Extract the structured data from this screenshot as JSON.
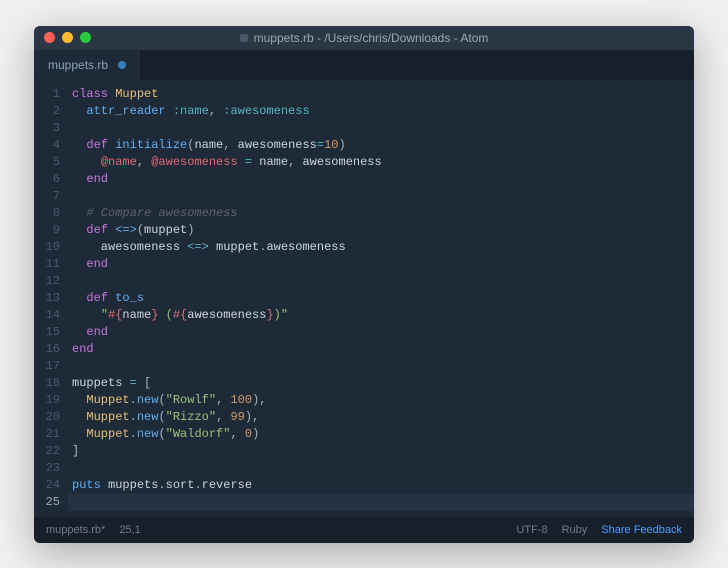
{
  "window": {
    "title": "muppets.rb - /Users/chris/Downloads - Atom"
  },
  "tab": {
    "label": "muppets.rb",
    "modified": true
  },
  "cursor": {
    "line": 25,
    "col": 1
  },
  "status": {
    "file": "muppets.rb*",
    "position": "25,1",
    "encoding": "UTF-8",
    "language": "Ruby",
    "feedback": "Share Feedback"
  },
  "code": {
    "lines": [
      {
        "n": 1,
        "t": [
          [
            "kw",
            "class"
          ],
          [
            "",
            " "
          ],
          [
            "cls",
            "Muppet"
          ]
        ]
      },
      {
        "n": 2,
        "t": [
          [
            "",
            "  "
          ],
          [
            "fn",
            "attr_reader"
          ],
          [
            "",
            " "
          ],
          [
            "sym",
            ":name"
          ],
          [
            "pun",
            ","
          ],
          [
            "",
            " "
          ],
          [
            "sym",
            ":awesomeness"
          ]
        ]
      },
      {
        "n": 3,
        "t": []
      },
      {
        "n": 4,
        "t": [
          [
            "",
            "  "
          ],
          [
            "kw",
            "def"
          ],
          [
            "",
            " "
          ],
          [
            "fn",
            "initialize"
          ],
          [
            "pun",
            "("
          ],
          [
            "",
            "name"
          ],
          [
            "pun",
            ","
          ],
          [
            "",
            " awesomeness"
          ],
          [
            "op",
            "="
          ],
          [
            "num",
            "10"
          ],
          [
            "pun",
            ")"
          ]
        ]
      },
      {
        "n": 5,
        "t": [
          [
            "",
            "    "
          ],
          [
            "var",
            "@name"
          ],
          [
            "pun",
            ","
          ],
          [
            "",
            " "
          ],
          [
            "var",
            "@awesomeness"
          ],
          [
            "",
            " "
          ],
          [
            "op",
            "="
          ],
          [
            "",
            " name"
          ],
          [
            "pun",
            ","
          ],
          [
            "",
            " awesomeness"
          ]
        ]
      },
      {
        "n": 6,
        "t": [
          [
            "",
            "  "
          ],
          [
            "kw",
            "end"
          ]
        ]
      },
      {
        "n": 7,
        "t": []
      },
      {
        "n": 8,
        "t": [
          [
            "",
            "  "
          ],
          [
            "cmt",
            "# Compare awesomeness"
          ]
        ]
      },
      {
        "n": 9,
        "t": [
          [
            "",
            "  "
          ],
          [
            "kw",
            "def"
          ],
          [
            "",
            " "
          ],
          [
            "fn",
            "<=>"
          ],
          [
            "pun",
            "("
          ],
          [
            "",
            "muppet"
          ],
          [
            "pun",
            ")"
          ]
        ]
      },
      {
        "n": 10,
        "t": [
          [
            "",
            "    awesomeness "
          ],
          [
            "op",
            "<=>"
          ],
          [
            "",
            " muppet"
          ],
          [
            "pun",
            "."
          ],
          [
            "",
            "awesomeness"
          ]
        ]
      },
      {
        "n": 11,
        "t": [
          [
            "",
            "  "
          ],
          [
            "kw",
            "end"
          ]
        ]
      },
      {
        "n": 12,
        "t": []
      },
      {
        "n": 13,
        "t": [
          [
            "",
            "  "
          ],
          [
            "kw",
            "def"
          ],
          [
            "",
            " "
          ],
          [
            "fn",
            "to_s"
          ]
        ]
      },
      {
        "n": 14,
        "t": [
          [
            "",
            "    "
          ],
          [
            "str",
            "\""
          ],
          [
            "interp",
            "#{"
          ],
          [
            "",
            "name"
          ],
          [
            "interp",
            "}"
          ],
          [
            "str",
            " ("
          ],
          [
            "interp",
            "#{"
          ],
          [
            "",
            "awesomeness"
          ],
          [
            "interp",
            "}"
          ],
          [
            "str",
            ")\""
          ]
        ]
      },
      {
        "n": 15,
        "t": [
          [
            "",
            "  "
          ],
          [
            "kw",
            "end"
          ]
        ]
      },
      {
        "n": 16,
        "t": [
          [
            "kw",
            "end"
          ]
        ]
      },
      {
        "n": 17,
        "t": []
      },
      {
        "n": 18,
        "t": [
          [
            "",
            "muppets "
          ],
          [
            "op",
            "="
          ],
          [
            "",
            " "
          ],
          [
            "pun",
            "["
          ]
        ]
      },
      {
        "n": 19,
        "t": [
          [
            "",
            "  "
          ],
          [
            "const",
            "Muppet"
          ],
          [
            "pun",
            "."
          ],
          [
            "fn",
            "new"
          ],
          [
            "pun",
            "("
          ],
          [
            "str",
            "\"Rowlf\""
          ],
          [
            "pun",
            ","
          ],
          [
            "",
            " "
          ],
          [
            "num",
            "100"
          ],
          [
            "pun",
            "),"
          ]
        ]
      },
      {
        "n": 20,
        "t": [
          [
            "",
            "  "
          ],
          [
            "const",
            "Muppet"
          ],
          [
            "pun",
            "."
          ],
          [
            "fn",
            "new"
          ],
          [
            "pun",
            "("
          ],
          [
            "str",
            "\"Rizzo\""
          ],
          [
            "pun",
            ","
          ],
          [
            "",
            " "
          ],
          [
            "num",
            "99"
          ],
          [
            "pun",
            "),"
          ]
        ]
      },
      {
        "n": 21,
        "t": [
          [
            "",
            "  "
          ],
          [
            "const",
            "Muppet"
          ],
          [
            "pun",
            "."
          ],
          [
            "fn",
            "new"
          ],
          [
            "pun",
            "("
          ],
          [
            "str",
            "\"Waldorf\""
          ],
          [
            "pun",
            ","
          ],
          [
            "",
            " "
          ],
          [
            "num",
            "0"
          ],
          [
            "pun",
            ")"
          ]
        ]
      },
      {
        "n": 22,
        "t": [
          [
            "pun",
            "]"
          ]
        ]
      },
      {
        "n": 23,
        "t": []
      },
      {
        "n": 24,
        "t": [
          [
            "fn",
            "puts"
          ],
          [
            "",
            " muppets"
          ],
          [
            "pun",
            "."
          ],
          [
            "",
            "sort"
          ],
          [
            "pun",
            "."
          ],
          [
            "",
            "reverse"
          ]
        ]
      },
      {
        "n": 25,
        "t": [],
        "active": true
      }
    ]
  }
}
